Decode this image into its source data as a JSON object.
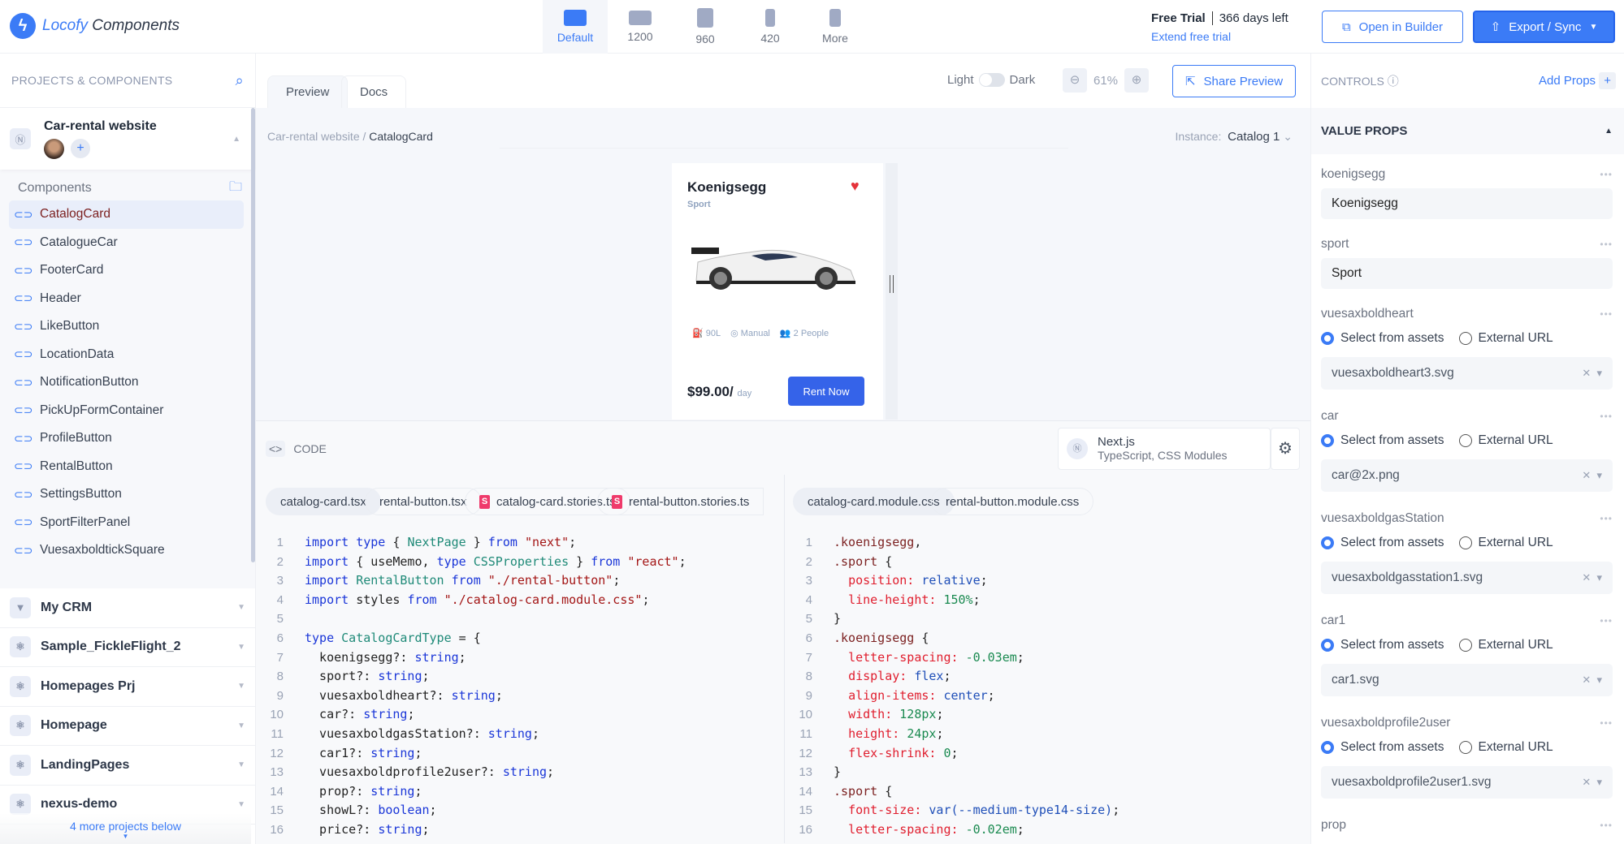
{
  "app": {
    "brand": "Locofy",
    "product": "Components"
  },
  "devices": [
    {
      "label": "Default",
      "active": true
    },
    {
      "label": "1200"
    },
    {
      "label": "960"
    },
    {
      "label": "420"
    },
    {
      "label": "More"
    }
  ],
  "trial": {
    "plan": "Free Trial",
    "days_left": "366 days left",
    "extend": "Extend free trial"
  },
  "header_buttons": {
    "open_builder": "Open in Builder",
    "export": "Export / Sync"
  },
  "sidebar": {
    "title": "PROJECTS & COMPONENTS",
    "project": "Car-rental website",
    "components_label": "Components",
    "components": [
      "CatalogCard",
      "CatalogueCar",
      "FooterCard",
      "Header",
      "LikeButton",
      "LocationData",
      "NotificationButton",
      "PickUpFormContainer",
      "ProfileButton",
      "RentalButton",
      "SettingsButton",
      "SportFilterPanel",
      "VuesaxboldtickSquare"
    ],
    "selected_component": "CatalogCard",
    "projects": [
      {
        "name": "My CRM",
        "icon": "vue-icon"
      },
      {
        "name": "Sample_FickleFlight_2",
        "icon": "react-icon"
      },
      {
        "name": "Homepages Prj",
        "icon": "react-icon"
      },
      {
        "name": "Homepage",
        "icon": "react-icon"
      },
      {
        "name": "LandingPages",
        "icon": "react-icon"
      },
      {
        "name": "nexus-demo",
        "icon": "react-icon"
      }
    ],
    "more_projects": "4 more projects below"
  },
  "preview": {
    "tabs": [
      "Preview",
      "Docs"
    ],
    "theme_light": "Light",
    "theme_dark": "Dark",
    "zoom": "61%",
    "share": "Share Preview",
    "breadcrumb_parent": "Car-rental website",
    "breadcrumb_current": "CatalogCard",
    "instance_label": "Instance:",
    "instance_value": "Catalog 1"
  },
  "card": {
    "title": "Koenigsegg",
    "subtitle": "Sport",
    "fuel": "90L",
    "transmission": "Manual",
    "capacity": "2 People",
    "price": "$99.00/",
    "per": "day",
    "cta": "Rent Now",
    "heart_color": "#e5333a",
    "button_color": "#3563e9"
  },
  "code": {
    "label": "CODE",
    "framework": "Next.js",
    "framework_detail": "TypeScript, CSS Modules",
    "left_tabs": [
      "catalog-card.tsx",
      "rental-button.tsx",
      "catalog-card.stories.ts",
      "rental-button.stories.ts"
    ],
    "right_tabs": [
      "catalog-card.module.css",
      "rental-button.module.css"
    ],
    "left_lines": [
      [
        [
          "kw",
          "import"
        ],
        [
          "tx",
          " "
        ],
        [
          "kw",
          "type"
        ],
        [
          "tx",
          " { "
        ],
        [
          "ty",
          "NextPage"
        ],
        [
          "tx",
          " } "
        ],
        [
          "kw",
          "from"
        ],
        [
          "tx",
          " "
        ],
        [
          "st",
          "\"next\""
        ],
        [
          "tx",
          ";"
        ]
      ],
      [
        [
          "kw",
          "import"
        ],
        [
          "tx",
          " { useMemo, "
        ],
        [
          "kw",
          "type"
        ],
        [
          "tx",
          " "
        ],
        [
          "ty",
          "CSSProperties"
        ],
        [
          "tx",
          " } "
        ],
        [
          "kw",
          "from"
        ],
        [
          "tx",
          " "
        ],
        [
          "st",
          "\"react\""
        ],
        [
          "tx",
          ";"
        ]
      ],
      [
        [
          "kw",
          "import"
        ],
        [
          "tx",
          " "
        ],
        [
          "ty",
          "RentalButton"
        ],
        [
          "tx",
          " "
        ],
        [
          "kw",
          "from"
        ],
        [
          "tx",
          " "
        ],
        [
          "st",
          "\"./rental-button\""
        ],
        [
          "tx",
          ";"
        ]
      ],
      [
        [
          "kw",
          "import"
        ],
        [
          "tx",
          " styles "
        ],
        [
          "kw",
          "from"
        ],
        [
          "tx",
          " "
        ],
        [
          "st",
          "\"./catalog-card.module.css\""
        ],
        [
          "tx",
          ";"
        ]
      ],
      [],
      [
        [
          "kw",
          "type"
        ],
        [
          "tx",
          " "
        ],
        [
          "ty",
          "CatalogCardType"
        ],
        [
          "tx",
          " = {"
        ]
      ],
      [
        [
          "tx",
          "  koenigsegg?: "
        ],
        [
          "kw",
          "string"
        ],
        [
          "tx",
          ";"
        ]
      ],
      [
        [
          "tx",
          "  sport?: "
        ],
        [
          "kw",
          "string"
        ],
        [
          "tx",
          ";"
        ]
      ],
      [
        [
          "tx",
          "  vuesaxboldheart?: "
        ],
        [
          "kw",
          "string"
        ],
        [
          "tx",
          ";"
        ]
      ],
      [
        [
          "tx",
          "  car?: "
        ],
        [
          "kw",
          "string"
        ],
        [
          "tx",
          ";"
        ]
      ],
      [
        [
          "tx",
          "  vuesaxboldgasStation?: "
        ],
        [
          "kw",
          "string"
        ],
        [
          "tx",
          ";"
        ]
      ],
      [
        [
          "tx",
          "  car1?: "
        ],
        [
          "kw",
          "string"
        ],
        [
          "tx",
          ";"
        ]
      ],
      [
        [
          "tx",
          "  vuesaxboldprofile2user?: "
        ],
        [
          "kw",
          "string"
        ],
        [
          "tx",
          ";"
        ]
      ],
      [
        [
          "tx",
          "  prop?: "
        ],
        [
          "kw",
          "string"
        ],
        [
          "tx",
          ";"
        ]
      ],
      [
        [
          "tx",
          "  showL?: "
        ],
        [
          "kw",
          "boolean"
        ],
        [
          "tx",
          ";"
        ]
      ],
      [
        [
          "tx",
          "  price?: "
        ],
        [
          "kw",
          "string"
        ],
        [
          "tx",
          ";"
        ]
      ]
    ],
    "right_lines": [
      [
        [
          "sel",
          ".koenigsegg"
        ],
        [
          "tx",
          ","
        ]
      ],
      [
        [
          "sel",
          ".sport"
        ],
        [
          "tx",
          " {"
        ]
      ],
      [
        [
          "tx",
          "  "
        ],
        [
          "pr",
          "position:"
        ],
        [
          "tx",
          " "
        ],
        [
          "vl",
          "relative"
        ],
        [
          "tx",
          ";"
        ]
      ],
      [
        [
          "tx",
          "  "
        ],
        [
          "pr",
          "line-height:"
        ],
        [
          "tx",
          " "
        ],
        [
          "nm",
          "150%"
        ],
        [
          "tx",
          ";"
        ]
      ],
      [
        [
          "tx",
          "}"
        ]
      ],
      [
        [
          "sel",
          ".koenigsegg"
        ],
        [
          "tx",
          " {"
        ]
      ],
      [
        [
          "tx",
          "  "
        ],
        [
          "pr",
          "letter-spacing:"
        ],
        [
          "tx",
          " "
        ],
        [
          "nm",
          "-0.03em"
        ],
        [
          "tx",
          ";"
        ]
      ],
      [
        [
          "tx",
          "  "
        ],
        [
          "pr",
          "display:"
        ],
        [
          "tx",
          " "
        ],
        [
          "vl",
          "flex"
        ],
        [
          "tx",
          ";"
        ]
      ],
      [
        [
          "tx",
          "  "
        ],
        [
          "pr",
          "align-items:"
        ],
        [
          "tx",
          " "
        ],
        [
          "vl",
          "center"
        ],
        [
          "tx",
          ";"
        ]
      ],
      [
        [
          "tx",
          "  "
        ],
        [
          "pr",
          "width:"
        ],
        [
          "tx",
          " "
        ],
        [
          "nm",
          "128px"
        ],
        [
          "tx",
          ";"
        ]
      ],
      [
        [
          "tx",
          "  "
        ],
        [
          "pr",
          "height:"
        ],
        [
          "tx",
          " "
        ],
        [
          "nm",
          "24px"
        ],
        [
          "tx",
          ";"
        ]
      ],
      [
        [
          "tx",
          "  "
        ],
        [
          "pr",
          "flex-shrink:"
        ],
        [
          "tx",
          " "
        ],
        [
          "nm",
          "0"
        ],
        [
          "tx",
          ";"
        ]
      ],
      [
        [
          "tx",
          "}"
        ]
      ],
      [
        [
          "sel",
          ".sport"
        ],
        [
          "tx",
          " {"
        ]
      ],
      [
        [
          "tx",
          "  "
        ],
        [
          "pr",
          "font-size:"
        ],
        [
          "tx",
          " "
        ],
        [
          "vl",
          "var(--medium-type14-size)"
        ],
        [
          "tx",
          ";"
        ]
      ],
      [
        [
          "tx",
          "  "
        ],
        [
          "pr",
          "letter-spacing:"
        ],
        [
          "tx",
          " "
        ],
        [
          "nm",
          "-0.02em"
        ],
        [
          "tx",
          ";"
        ]
      ]
    ]
  },
  "controls": {
    "title": "CONTROLS",
    "add_props": "Add Props",
    "section": "VALUE PROPS",
    "opt_assets": "Select from assets",
    "opt_url": "External URL",
    "fields": [
      {
        "name": "koenigsegg",
        "type": "text",
        "value": "Koenigsegg"
      },
      {
        "name": "sport",
        "type": "text",
        "value": "Sport"
      },
      {
        "name": "vuesaxboldheart",
        "type": "asset",
        "value": "vuesaxboldheart3.svg"
      },
      {
        "name": "car",
        "type": "asset",
        "value": "car@2x.png"
      },
      {
        "name": "vuesaxboldgasStation",
        "type": "asset",
        "value": "vuesaxboldgasstation1.svg"
      },
      {
        "name": "car1",
        "type": "asset",
        "value": "car1.svg"
      },
      {
        "name": "vuesaxboldprofile2user",
        "type": "asset",
        "value": "vuesaxboldprofile2user1.svg"
      },
      {
        "name": "prop",
        "type": "text",
        "value": ""
      }
    ]
  }
}
